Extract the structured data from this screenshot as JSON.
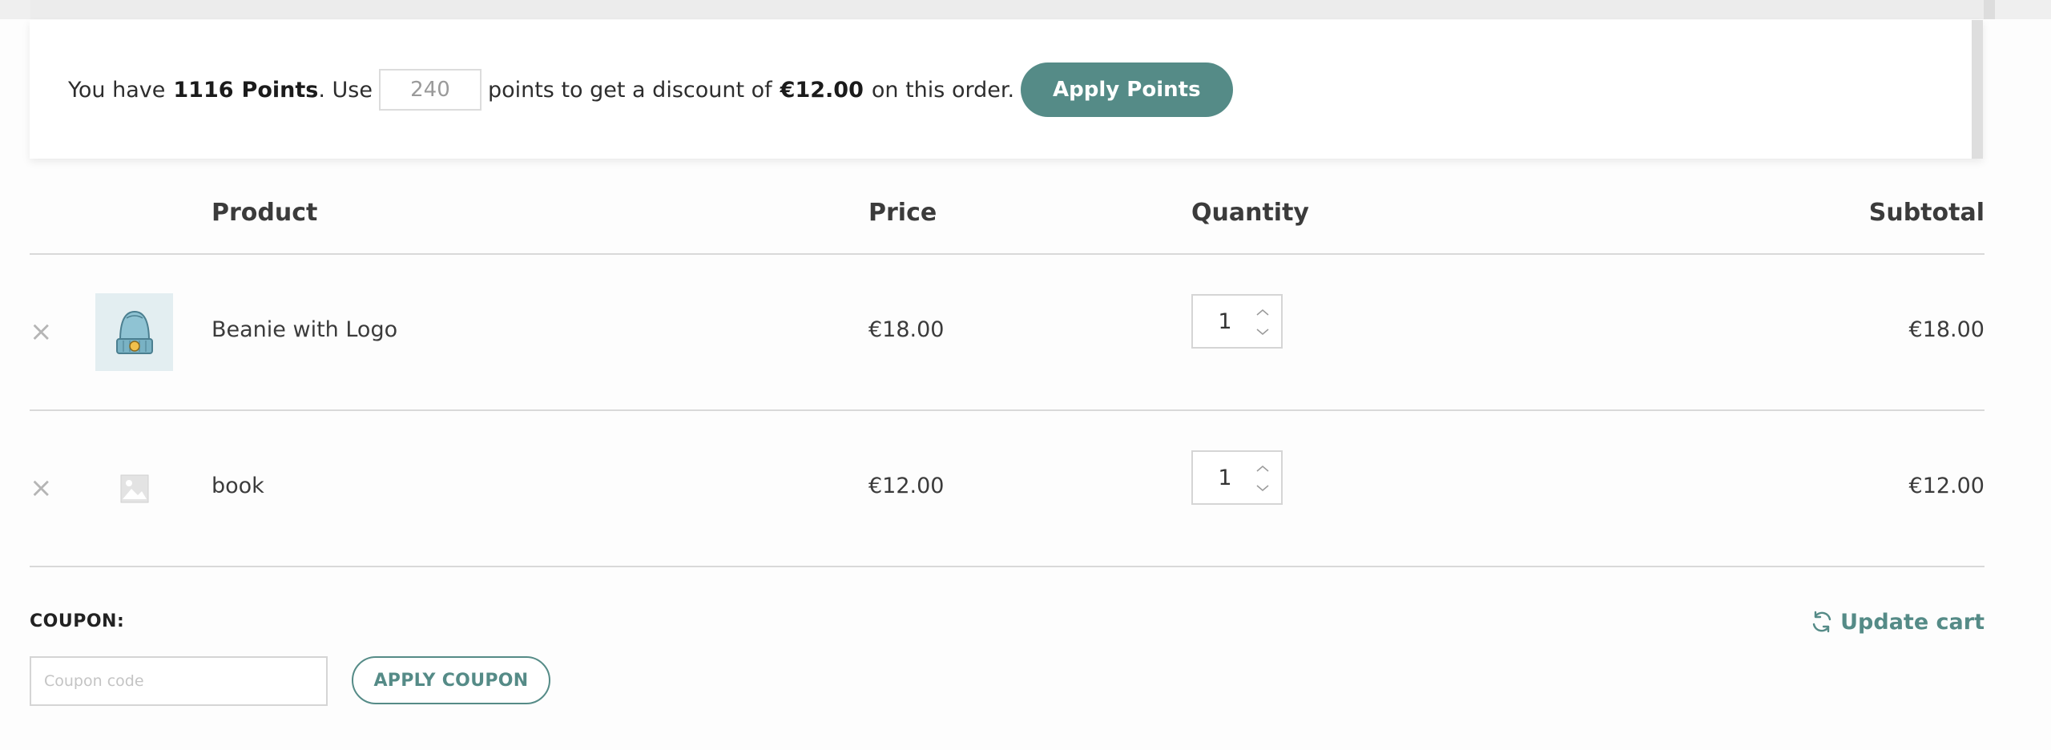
{
  "points_notice": {
    "prefix": "You have",
    "points_count": "1116",
    "points_word": "Points",
    "use_text": ". Use",
    "points_input_value": "240",
    "middle_text": "points to get a discount of",
    "discount_amount": "€12.00",
    "suffix": "on this order.",
    "apply_label": "Apply Points"
  },
  "cart": {
    "headers": {
      "product": "Product",
      "price": "Price",
      "quantity": "Quantity",
      "subtotal": "Subtotal"
    },
    "items": [
      {
        "name": "Beanie with Logo",
        "price": "€18.00",
        "quantity": "1",
        "subtotal": "€18.00",
        "thumbnail": "beanie-image"
      },
      {
        "name": "book",
        "price": "€12.00",
        "quantity": "1",
        "subtotal": "€12.00",
        "thumbnail": "placeholder-image-icon"
      }
    ],
    "remove_glyph": "×"
  },
  "coupon": {
    "label": "COUPON:",
    "placeholder": "Coupon code",
    "apply_label": "APPLY COUPON"
  },
  "update_cart_label": "Update cart",
  "colors": {
    "accent": "#558b87",
    "border": "#d9d9d9",
    "text": "#3b3b3b"
  }
}
